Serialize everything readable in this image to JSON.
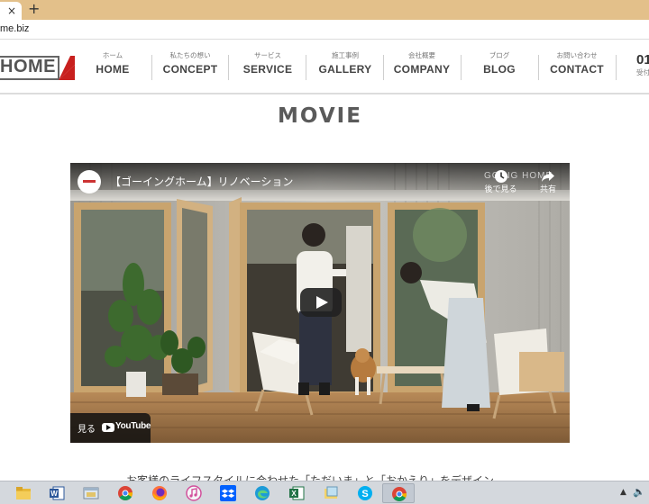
{
  "browser": {
    "tab_close": "×",
    "new_tab": "+",
    "url": "me.biz"
  },
  "site": {
    "logo_text": "HOME",
    "nav": [
      {
        "jp": "ホーム",
        "en": "HOME"
      },
      {
        "jp": "私たちの想い",
        "en": "CONCEPT"
      },
      {
        "jp": "サービス",
        "en": "SERVICE"
      },
      {
        "jp": "施工事例",
        "en": "GALLERY"
      },
      {
        "jp": "会社概要",
        "en": "COMPANY"
      },
      {
        "jp": "ブログ",
        "en": "BLOG"
      },
      {
        "jp": "お問い合わせ",
        "en": "CONTACT"
      }
    ],
    "phone_prefix": "01",
    "phone_sub": "受付"
  },
  "section": {
    "title": "MOVIE"
  },
  "video": {
    "title": "【ゴーイングホーム】リノベーション",
    "watch_later": "後で見る",
    "share": "共有",
    "watermark": "GOING HOME",
    "watch_on": "見る",
    "youtube": "YouTube"
  },
  "body_text": "お客様のライフスタイルに合わせた「ただいま」と「おかえり」をデザイン",
  "taskbar": {
    "icons": [
      "folder-icon",
      "word-icon",
      "explorer-icon",
      "chrome-icon",
      "firefox-icon",
      "itunes-icon",
      "dropbox-icon",
      "edge-icon",
      "excel-icon",
      "notes-icon",
      "skype-icon",
      "chrome-icon"
    ],
    "tray_arrow": "▲",
    "tray_volume": "🔈"
  },
  "colors": {
    "tabbar": "#e3c08a",
    "logo_red": "#c8201e",
    "text_dark": "#444444"
  }
}
